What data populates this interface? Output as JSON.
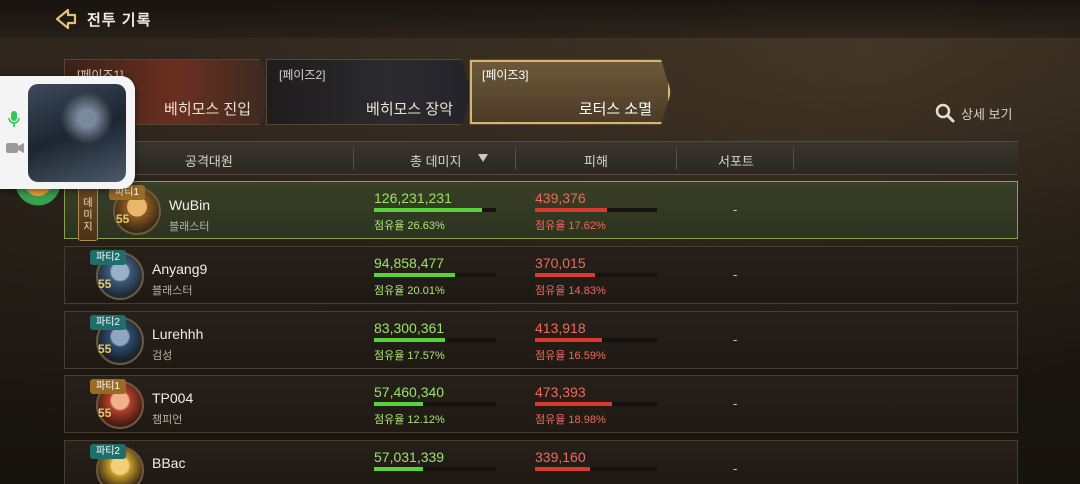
{
  "header": {
    "title": "전투 기록"
  },
  "tabs": [
    {
      "prefix": "[페이즈1]",
      "name": "베히모스 진입",
      "active": false
    },
    {
      "prefix": "[페이즈2]",
      "name": "베히모스 장악",
      "active": false
    },
    {
      "prefix": "[페이즈3]",
      "name": "로터스 소멸",
      "active": true
    }
  ],
  "detail": {
    "label": "상세 보기",
    "icon": "search-icon"
  },
  "table": {
    "headers": {
      "attacker": "공격대원",
      "total_damage": "총 데미지",
      "damage_taken": "피해",
      "support": "서포트"
    },
    "sort_icon": "sort-down-icon",
    "rows": [
      {
        "party": "파티1",
        "level": "55",
        "name": "WuBin",
        "class": "블래스터",
        "damage": "126,231,231",
        "damage_share": "점유율 26.63%",
        "damage_ratio": 0.2663,
        "taken": "439,376",
        "taken_share": "점유율 17.62%",
        "taken_ratio": 0.1762,
        "support": "-",
        "badge": "데\n미\n지"
      },
      {
        "party": "파티2",
        "level": "55",
        "name": "Anyang9",
        "class": "블래스터",
        "damage": "94,858,477",
        "damage_share": "점유율 20.01%",
        "damage_ratio": 0.2001,
        "taken": "370,015",
        "taken_share": "점유율 14.83%",
        "taken_ratio": 0.1483,
        "support": "-"
      },
      {
        "party": "파티2",
        "level": "55",
        "name": "Lurehhh",
        "class": "검성",
        "damage": "83,300,361",
        "damage_share": "점유율 17.57%",
        "damage_ratio": 0.1757,
        "taken": "413,918",
        "taken_share": "점유율 16.59%",
        "taken_ratio": 0.1659,
        "support": "-"
      },
      {
        "party": "파티1",
        "level": "55",
        "name": "TP004",
        "class": "챔피언",
        "damage": "57,460,340",
        "damage_share": "점유율 12.12%",
        "damage_ratio": 0.1212,
        "taken": "473,393",
        "taken_share": "점유율 18.98%",
        "taken_ratio": 0.1898,
        "support": "-"
      },
      {
        "party": "파티2",
        "level": "55",
        "name": "BBac",
        "class": "",
        "damage": "57,031,339",
        "damage_share": "",
        "damage_ratio": 0.12,
        "taken": "339,160",
        "taken_share": "",
        "taken_ratio": 0.136,
        "support": "-"
      }
    ]
  },
  "overlay": {
    "mic_icon": "microphone-icon",
    "camera_icon": "video-camera-icon"
  },
  "colors": {
    "accent": "#d9b56c",
    "damage": "#9be36a",
    "taken": "#ee6a5d",
    "highlight_border": "#8da04e"
  }
}
